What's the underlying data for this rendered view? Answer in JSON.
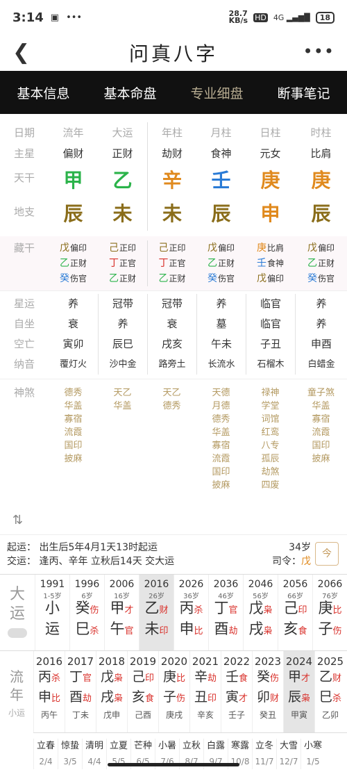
{
  "status": {
    "time": "3:14",
    "net": "28.7\nKB/s",
    "hd": "HD",
    "signal": "4G",
    "battery": "18"
  },
  "header": {
    "title": "问真八字"
  },
  "tabs": [
    "基本信息",
    "基本命盘",
    "专业细盘",
    "断事笔记"
  ],
  "pillars": {
    "labels": [
      "日期",
      "主星",
      "天干",
      "地支"
    ],
    "heads": [
      "流年",
      "大运",
      "年柱",
      "月柱",
      "日柱",
      "时柱"
    ],
    "stars": [
      "偏财",
      "正财",
      "劫财",
      "食神",
      "元女",
      "比肩"
    ],
    "stems": [
      "甲",
      "乙",
      "辛",
      "壬",
      "庚",
      "庚"
    ],
    "stem_colors": [
      "#2bb34a",
      "#2bb34a",
      "#e08a1e",
      "#2a7bd6",
      "#e08a1e",
      "#e08a1e"
    ],
    "branches": [
      "辰",
      "未",
      "未",
      "辰",
      "申",
      "辰"
    ],
    "branch_colors": [
      "#8a6d1a",
      "#8a6d1a",
      "#8a6d1a",
      "#8a6d1a",
      "#e08a1e",
      "#8a6d1a"
    ]
  },
  "hidden": {
    "label": "藏干",
    "cols": [
      [
        [
          "戊",
          "偏印",
          "#8a6d1a"
        ],
        [
          "乙",
          "正财",
          "#2bb34a"
        ],
        [
          "癸",
          "伤官",
          "#2a7bd6"
        ]
      ],
      [
        [
          "己",
          "正印",
          "#8a6d1a"
        ],
        [
          "丁",
          "正官",
          "#d9312b"
        ],
        [
          "乙",
          "正财",
          "#2bb34a"
        ]
      ],
      [
        [
          "己",
          "正印",
          "#8a6d1a"
        ],
        [
          "丁",
          "正官",
          "#d9312b"
        ],
        [
          "乙",
          "正财",
          "#2bb34a"
        ]
      ],
      [
        [
          "戊",
          "偏印",
          "#8a6d1a"
        ],
        [
          "乙",
          "正财",
          "#2bb34a"
        ],
        [
          "癸",
          "伤官",
          "#2a7bd6"
        ]
      ],
      [
        [
          "庚",
          "比肩",
          "#e08a1e"
        ],
        [
          "壬",
          "食神",
          "#2a7bd6"
        ],
        [
          "戊",
          "偏印",
          "#8a6d1a"
        ]
      ],
      [
        [
          "戊",
          "偏印",
          "#8a6d1a"
        ],
        [
          "乙",
          "正财",
          "#2bb34a"
        ],
        [
          "癸",
          "伤官",
          "#2a7bd6"
        ]
      ]
    ]
  },
  "stage": {
    "labels": [
      "星运",
      "自坐",
      "空亡",
      "纳音"
    ],
    "rows": [
      [
        "养",
        "冠带",
        "冠带",
        "养",
        "临官",
        "养"
      ],
      [
        "衰",
        "养",
        "衰",
        "墓",
        "临官",
        "养"
      ],
      [
        "寅卯",
        "辰巳",
        "戌亥",
        "午未",
        "子丑",
        "申酉"
      ],
      [
        "覆灯火",
        "沙中金",
        "路旁土",
        "长流水",
        "石榴木",
        "白蜡金"
      ]
    ]
  },
  "shensha": {
    "label": "神煞",
    "cols": [
      [
        "德秀",
        "华盖",
        "寡宿",
        "流霞",
        "国印",
        "披麻"
      ],
      [
        "天乙",
        "华盖"
      ],
      [
        "天乙",
        "德秀"
      ],
      [
        "天德",
        "月德",
        "德秀",
        "华盖",
        "寡宿",
        "流霞",
        "国印",
        "披麻"
      ],
      [
        "禄神",
        "学堂",
        "词馆",
        "红鸾",
        "八专",
        "孤辰",
        "劫煞",
        "四废"
      ],
      [
        "童子煞",
        "华盖",
        "寡宿",
        "流霞",
        "国印",
        "披麻"
      ]
    ]
  },
  "qiyun": {
    "line1": "起运：  出生后5年4月1天13时起运",
    "line2": "交运：  逢丙、辛年 立秋后14天 交大运",
    "age": "34岁",
    "siling": "司令：",
    "siling_val": "戊",
    "btn": "今"
  },
  "dayun": {
    "label": [
      "大",
      "运"
    ],
    "cols": [
      {
        "y": "1991",
        "a": "1-5岁",
        "g1": "小",
        "s1": "",
        "g2": "运",
        "s2": ""
      },
      {
        "y": "1996",
        "a": "6岁",
        "g1": "癸",
        "s1": "伤",
        "g2": "巳",
        "s2": "杀"
      },
      {
        "y": "2006",
        "a": "16岁",
        "g1": "甲",
        "s1": "才",
        "g2": "午",
        "s2": "官"
      },
      {
        "y": "2016",
        "a": "26岁",
        "g1": "乙",
        "s1": "财",
        "g2": "未",
        "s2": "印"
      },
      {
        "y": "2026",
        "a": "36岁",
        "g1": "丙",
        "s1": "杀",
        "g2": "申",
        "s2": "比"
      },
      {
        "y": "2036",
        "a": "46岁",
        "g1": "丁",
        "s1": "官",
        "g2": "酉",
        "s2": "劫"
      },
      {
        "y": "2046",
        "a": "56岁",
        "g1": "戊",
        "s1": "枭",
        "g2": "戌",
        "s2": "枭"
      },
      {
        "y": "2056",
        "a": "66岁",
        "g1": "己",
        "s1": "印",
        "g2": "亥",
        "s2": "食"
      },
      {
        "y": "2066",
        "a": "76岁",
        "g1": "庚",
        "s1": "比",
        "g2": "子",
        "s2": "伤"
      }
    ]
  },
  "liunian": {
    "label": [
      "流",
      "年"
    ],
    "sub": "小运",
    "cols": [
      {
        "y": "2016",
        "g1": "丙",
        "s1": "杀",
        "g2": "申",
        "s2": "比",
        "x": "丙午"
      },
      {
        "y": "2017",
        "g1": "丁",
        "s1": "官",
        "g2": "酉",
        "s2": "劫",
        "x": "丁未"
      },
      {
        "y": "2018",
        "g1": "戊",
        "s1": "枭",
        "g2": "戌",
        "s2": "枭",
        "x": "戊申"
      },
      {
        "y": "2019",
        "g1": "己",
        "s1": "印",
        "g2": "亥",
        "s2": "食",
        "x": "己酉"
      },
      {
        "y": "2020",
        "g1": "庚",
        "s1": "比",
        "g2": "子",
        "s2": "伤",
        "x": "庚戌"
      },
      {
        "y": "2021",
        "g1": "辛",
        "s1": "劫",
        "g2": "丑",
        "s2": "印",
        "x": "辛亥"
      },
      {
        "y": "2022",
        "g1": "壬",
        "s1": "食",
        "g2": "寅",
        "s2": "才",
        "x": "壬子"
      },
      {
        "y": "2023",
        "g1": "癸",
        "s1": "伤",
        "g2": "卯",
        "s2": "财",
        "x": "癸丑"
      },
      {
        "y": "2024",
        "g1": "甲",
        "s1": "才",
        "g2": "辰",
        "s2": "枭",
        "x": "甲寅"
      },
      {
        "y": "2025",
        "g1": "乙",
        "s1": "财",
        "g2": "巳",
        "s2": "杀",
        "x": "乙卯"
      }
    ]
  },
  "jieqi": [
    {
      "n": "立春",
      "d": "2/4"
    },
    {
      "n": "惊蛰",
      "d": "3/5"
    },
    {
      "n": "清明",
      "d": "4/4"
    },
    {
      "n": "立夏",
      "d": "5/5"
    },
    {
      "n": "芒种",
      "d": "6/5"
    },
    {
      "n": "小暑",
      "d": "7/6"
    },
    {
      "n": "立秋",
      "d": "8/7"
    },
    {
      "n": "白露",
      "d": "9/7"
    },
    {
      "n": "寒露",
      "d": "10/8"
    },
    {
      "n": "立冬",
      "d": "11/7"
    },
    {
      "n": "大雪",
      "d": "12/7"
    },
    {
      "n": "小寒",
      "d": "1/5"
    }
  ]
}
